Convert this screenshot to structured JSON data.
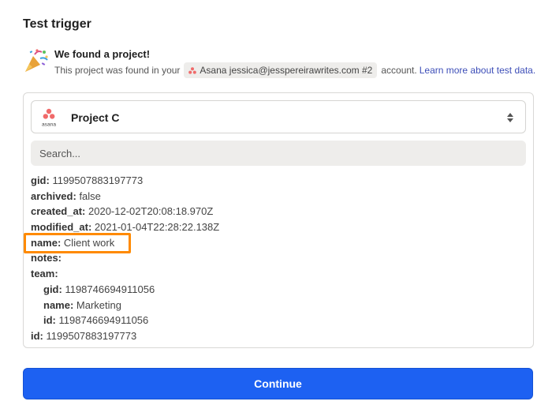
{
  "section_title": "Test trigger",
  "found": {
    "title": "We found a project!",
    "desc_prefix": "This project was found in your",
    "account_chip": "Asana jessica@jesspereirawrites.com #2",
    "desc_suffix": "account.",
    "learn_link": "Learn more about test data."
  },
  "select": {
    "logo_text": "asana",
    "value": "Project C"
  },
  "search": {
    "placeholder": "Search..."
  },
  "fields": {
    "gid": {
      "key": "gid:",
      "value": "1199507883197773"
    },
    "archived": {
      "key": "archived:",
      "value": "false"
    },
    "created_at": {
      "key": "created_at:",
      "value": "2020-12-02T20:08:18.970Z"
    },
    "modified_at": {
      "key": "modified_at:",
      "value": "2021-01-04T22:28:22.138Z"
    },
    "name": {
      "key": "name:",
      "value": "Client work"
    },
    "notes": {
      "key": "notes:",
      "value": ""
    },
    "team": {
      "key": "team:"
    },
    "team_gid": {
      "key": "gid:",
      "value": "1198746694911056"
    },
    "team_name": {
      "key": "name:",
      "value": "Marketing"
    },
    "team_id": {
      "key": "id:",
      "value": "1198746694911056"
    },
    "id": {
      "key": "id:",
      "value": "1199507883197773"
    }
  },
  "colors": {
    "highlight": "#ff8a00",
    "primary_button": "#1d61f2",
    "asana_brand": "#f06a6a",
    "link": "#3d4eb8"
  },
  "continue_label": "Continue"
}
